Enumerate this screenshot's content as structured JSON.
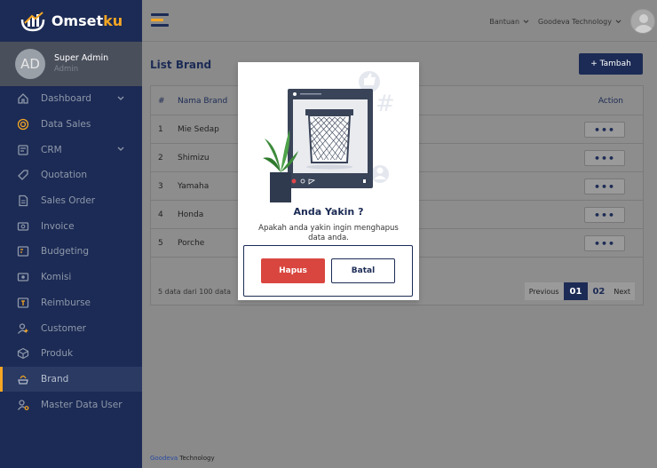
{
  "app": {
    "logo_main": "Omset",
    "logo_accent": "ku"
  },
  "profile": {
    "initials": "AD",
    "name": "Super Admin",
    "role": "Admin"
  },
  "sidebar": {
    "items": [
      {
        "label": "Dashboard",
        "icon": "home-icon",
        "caret": true
      },
      {
        "label": "Data Sales",
        "icon": "target-icon"
      },
      {
        "label": "CRM",
        "icon": "crm-icon",
        "caret": true
      },
      {
        "label": "Quotation",
        "icon": "tag-icon"
      },
      {
        "label": "Sales Order",
        "icon": "document-icon"
      },
      {
        "label": "Invoice",
        "icon": "invoice-icon"
      },
      {
        "label": "Budgeting",
        "icon": "budget-icon"
      },
      {
        "label": "Komisi",
        "icon": "money-icon"
      },
      {
        "label": "Reimburse",
        "icon": "reimburse-icon"
      },
      {
        "label": "Customer",
        "icon": "user-add-icon"
      },
      {
        "label": "Produk",
        "icon": "box-icon"
      },
      {
        "label": "Brand",
        "icon": "brand-icon",
        "active": true
      },
      {
        "label": "Master Data User",
        "icon": "user-settings-icon"
      }
    ]
  },
  "topbar": {
    "help": "Bantuan",
    "company": "Goodeva Technology"
  },
  "page": {
    "title": "List Brand",
    "add_label": "+ Tambah"
  },
  "table": {
    "headers": {
      "num": "#",
      "name": "Nama Brand",
      "action": "Action"
    },
    "rows": [
      {
        "num": "1",
        "name": "Mie Sedap"
      },
      {
        "num": "2",
        "name": "Shimizu"
      },
      {
        "num": "3",
        "name": "Yamaha"
      },
      {
        "num": "4",
        "name": "Honda"
      },
      {
        "num": "5",
        "name": "Porche"
      }
    ],
    "action_label": "•••",
    "info": "5 data dari 100 data"
  },
  "pager": {
    "prev": "Previous",
    "p1": "01",
    "p2": "02",
    "next": "Next"
  },
  "footer": {
    "brand": "Goodeva",
    "rest": " Technology"
  },
  "modal": {
    "title": "Anda Yakin ?",
    "message": "Apakah anda yakin ingin menghapus data anda.",
    "delete_label": "Hapus",
    "cancel_label": "Batal"
  },
  "colors": {
    "primary": "#1c2b55",
    "accent": "#f5a623",
    "danger": "#d9463f"
  }
}
